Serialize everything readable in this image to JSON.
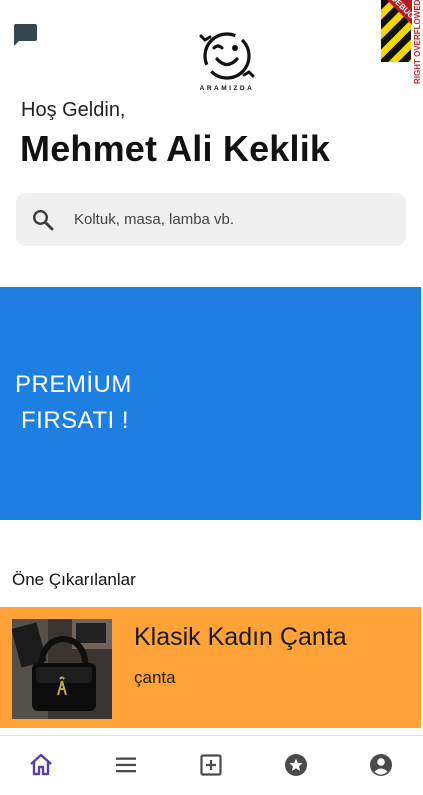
{
  "header": {
    "logo_text": "ARAMIZDA",
    "debug_banner_text": "DEBUG",
    "debug_side_text": "RIGHT OVERFLOWED BY"
  },
  "greeting": "Hoş Geldin,",
  "user_name": "Mehmet Ali Keklik",
  "search": {
    "placeholder": "Koltuk, masa, lamba vb."
  },
  "promo": {
    "line1": "PREMİUM",
    "line2": "FIRSATI !"
  },
  "featured": {
    "title": "Öne Çıkarılanlar",
    "items": [
      {
        "title": "Klasik Kadın Çanta",
        "category": "çanta"
      }
    ]
  },
  "nav": {
    "items": [
      {
        "icon": "home-icon",
        "active": true
      },
      {
        "icon": "menu-icon",
        "active": false
      },
      {
        "icon": "add-box-icon",
        "active": false
      },
      {
        "icon": "star-circle-icon",
        "active": false
      },
      {
        "icon": "account-circle-icon",
        "active": false
      }
    ]
  },
  "colors": {
    "promo_bg": "#1e7fe3",
    "card_bg": "#ffa238",
    "search_bg": "#efefef",
    "nav_active": "#5b3fa0",
    "nav_inactive": "#4a4a4a"
  }
}
